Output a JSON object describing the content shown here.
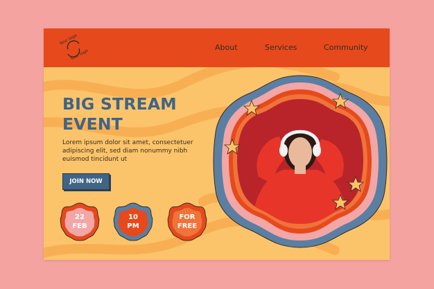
{
  "logo": {
    "line1": "Your logo",
    "line2": "Your logo"
  },
  "nav": {
    "about": "About",
    "services": "Services",
    "community": "Community"
  },
  "hero": {
    "title": "BIG STREAM\nEVENT",
    "description": "Lorem ipsum dolor sit amet, consectetuer adipiscing elit, sed diam nonummy nibh euismod tincidunt ut",
    "cta": "JOIN NOW"
  },
  "badges": [
    {
      "line1": "22",
      "line2": "FEB"
    },
    {
      "line1": "10",
      "line2": "PM"
    },
    {
      "line1": "FOR",
      "line2": "FREE"
    }
  ],
  "colors": {
    "background": "#f5a3a0",
    "page": "#fbc46a",
    "topbar": "#e64a1c",
    "title": "#3f6486",
    "accent_red": "#e64a1c",
    "accent_blue": "#5a7fa3"
  }
}
